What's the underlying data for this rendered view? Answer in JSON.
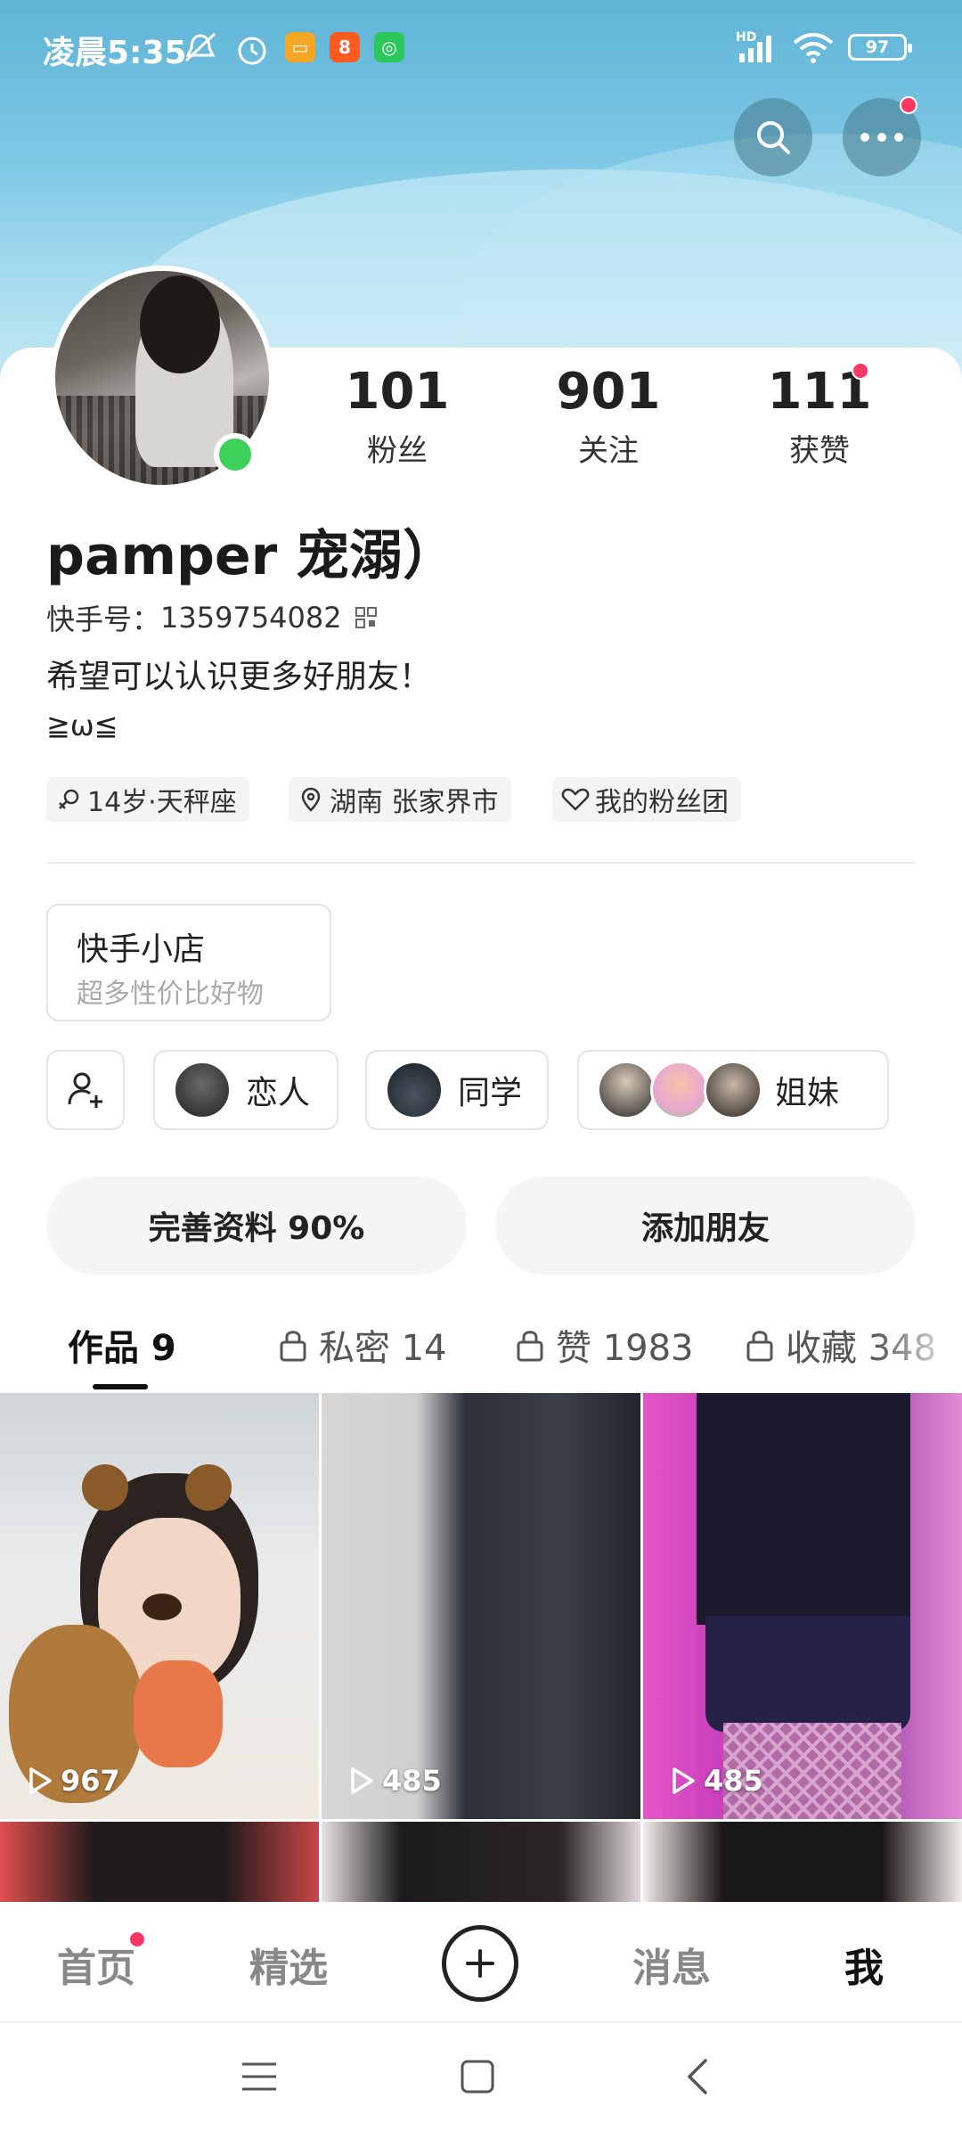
{
  "status_bar": {
    "time": "凌晨5:35",
    "battery": "97",
    "network": "HD"
  },
  "profile": {
    "stats": [
      {
        "value": "101",
        "label": "粉丝"
      },
      {
        "value": "901",
        "label": "关注"
      },
      {
        "value": "111",
        "label": "获赞"
      }
    ],
    "username": "pamper 宠溺）",
    "kuaishou_id_label": "快手号：",
    "kuaishou_id": "1359754082",
    "bio_line1": "希望可以认识更多好朋友！",
    "bio_line2": "≧ω≦",
    "tags": [
      "14岁·天秤座",
      "湖南 张家界市",
      "我的粉丝团"
    ]
  },
  "shop": {
    "title": "快手小店",
    "subtitle": "超多性价比好物"
  },
  "relations": [
    "恋人",
    "同学",
    "姐妹"
  ],
  "actions": {
    "complete_profile": "完善资料 90%",
    "add_friend": "添加朋友"
  },
  "tabs": [
    {
      "label": "作品 9",
      "locked": false
    },
    {
      "label": "私密 14",
      "locked": true
    },
    {
      "label": "赞 1983",
      "locked": true
    },
    {
      "label": "收藏 348",
      "locked": true
    }
  ],
  "videos": [
    {
      "plays": "967"
    },
    {
      "plays": "485"
    },
    {
      "plays": "485"
    }
  ],
  "bottom_nav": [
    "首页",
    "精选",
    "消息",
    "我"
  ],
  "colors": {
    "accent_red": "#fe3666",
    "online_green": "#3dd05a"
  },
  "icons": {
    "header": [
      "search-icon",
      "more-icon"
    ],
    "system_nav": [
      "menu-icon",
      "home-icon",
      "back-icon"
    ]
  }
}
